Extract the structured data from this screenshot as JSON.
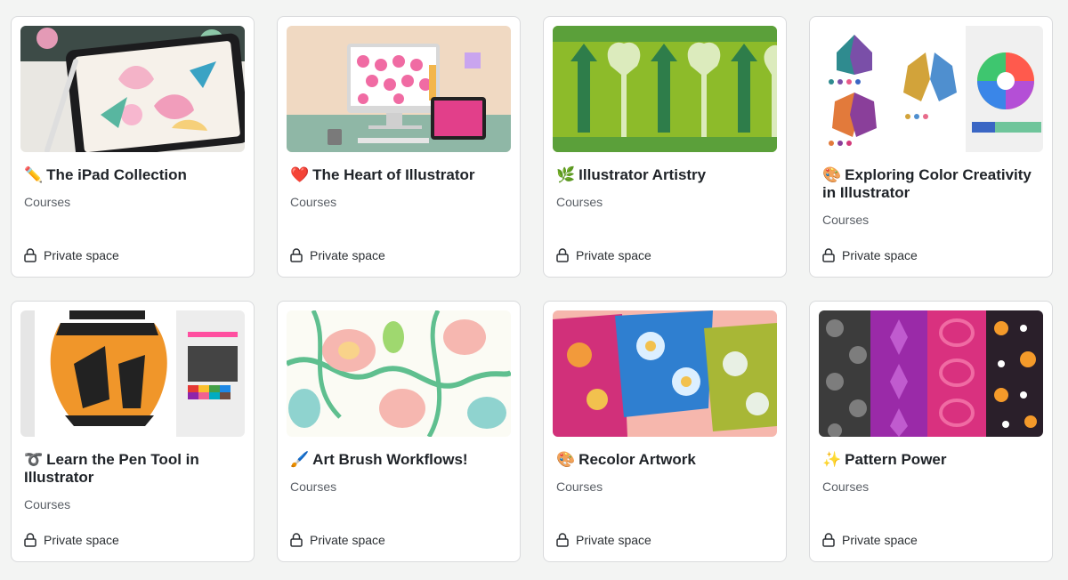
{
  "cards": [
    {
      "emoji": "✏️",
      "title": "The iPad Collection",
      "subtitle": "Courses",
      "privacy": "Private space",
      "thumb": "ipad-floral-thumbnail",
      "lines": 1
    },
    {
      "emoji": "❤️",
      "title": "The Heart of Illustrator",
      "subtitle": "Courses",
      "privacy": "Private space",
      "thumb": "desk-hearts-thumbnail",
      "lines": 1
    },
    {
      "emoji": "🌿",
      "title": "Illustrator Artistry",
      "subtitle": "Courses",
      "privacy": "Private space",
      "thumb": "green-pattern-thumbnail",
      "lines": 1
    },
    {
      "emoji": "🎨",
      "title": "Exploring Color Creativity in Illustrator",
      "subtitle": "Courses",
      "privacy": "Private space",
      "thumb": "butterflies-color-wheel-thumbnail",
      "lines": 2
    },
    {
      "emoji": "➰",
      "title": "Learn the Pen Tool in Illustrator",
      "subtitle": "Courses",
      "privacy": "Private space",
      "thumb": "greek-vase-thumbnail",
      "lines": 2
    },
    {
      "emoji": "🖌️",
      "title": "Art Brush Workflows!",
      "subtitle": "Courses",
      "privacy": "Private space",
      "thumb": "pastel-floral-thumbnail",
      "lines": 1
    },
    {
      "emoji": "🎨",
      "title": "Recolor Artwork",
      "subtitle": "Courses",
      "privacy": "Private space",
      "thumb": "fabric-swatches-thumbnail",
      "lines": 1
    },
    {
      "emoji": "✨",
      "title": "Pattern Power",
      "subtitle": "Courses",
      "privacy": "Private space",
      "thumb": "pattern-strips-thumbnail",
      "lines": 1
    }
  ],
  "colors": {
    "background": "#f3f4f3",
    "card_border": "#d9dadc",
    "title": "#1f2328",
    "subtitle": "#5a5f66"
  }
}
